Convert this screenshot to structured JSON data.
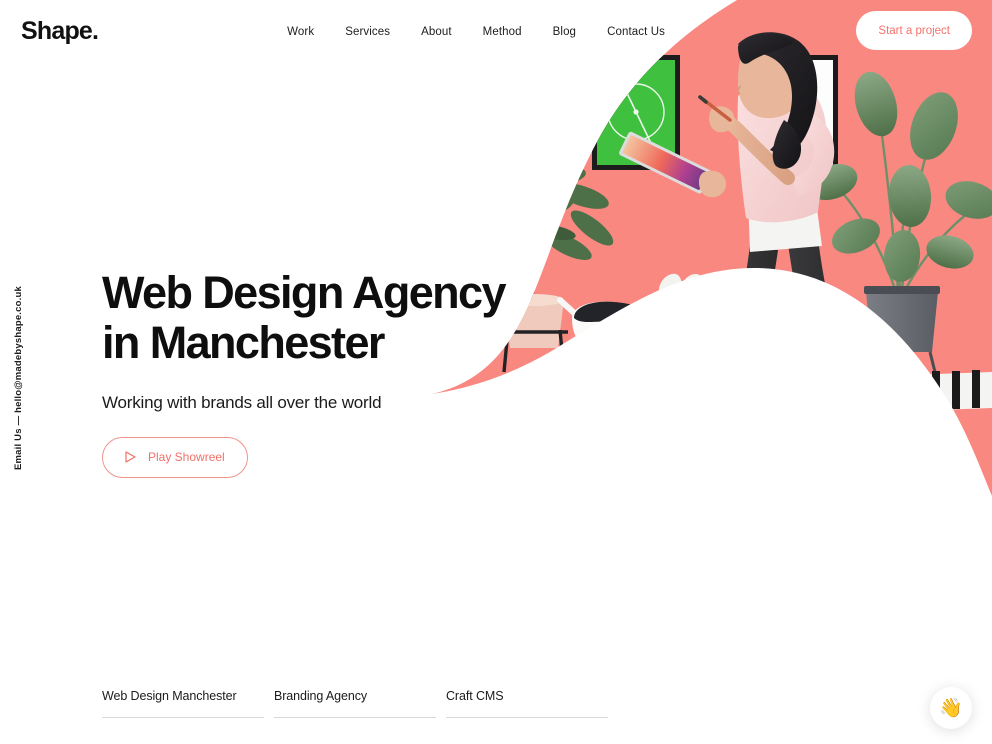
{
  "brand": {
    "logo": "Shape.",
    "accent_pink": "#F98880",
    "accent_text_pink": "#F8716B",
    "text_dark": "#111111",
    "background": "#FFFFFF"
  },
  "header": {
    "nav": [
      {
        "label": "Work"
      },
      {
        "label": "Services"
      },
      {
        "label": "About"
      },
      {
        "label": "Method"
      },
      {
        "label": "Blog"
      },
      {
        "label": "Contact Us"
      }
    ],
    "cta": {
      "label": "Start a project"
    }
  },
  "email_rail": {
    "prefix": "Email Us",
    "separator": "—",
    "address": "hello@madebyshape.co.uk",
    "full": "Email Us — hello@madebyshape.co.uk"
  },
  "hero": {
    "heading": "Web Design Agency\nin Manchester",
    "heading_line_1": "Web Design Agency",
    "heading_line_2": "in Manchester",
    "subheading": "Working with brands all over the world",
    "showreel_button": {
      "label": "Play Showreel",
      "icon": "play-icon"
    },
    "illustration": {
      "description": "3D illustration of a woman drawing on a tablet in front of a framed green poster, with houseplants, a dog and a striped rug",
      "poster_color": "#3FC13F",
      "frame_color": "#1C1C1C",
      "rug": "black and white stripes"
    }
  },
  "bottom_links": [
    {
      "label": "Web Design Manchester"
    },
    {
      "label": "Branding Agency"
    },
    {
      "label": "Craft CMS"
    }
  ],
  "chat": {
    "icon": "waving-hand-icon",
    "glyph": "👋"
  }
}
